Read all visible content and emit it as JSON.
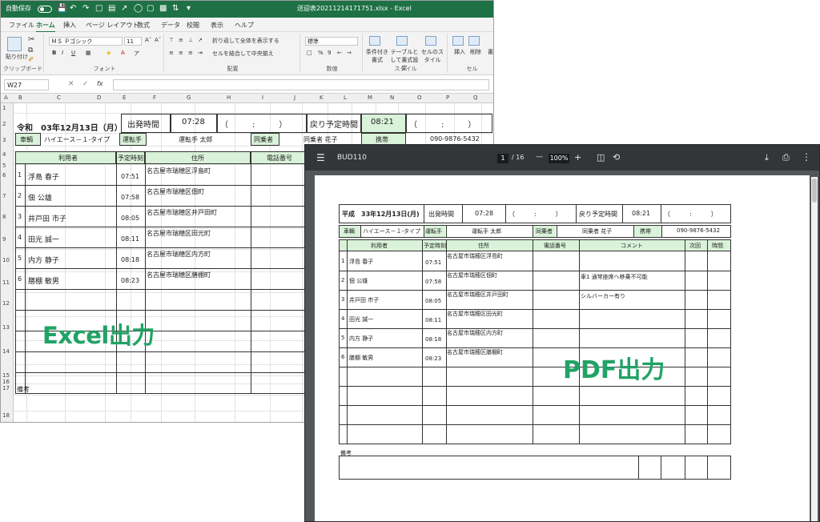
{
  "excel": {
    "autosave_label": "自動保存",
    "toggle_state": "オフ",
    "file_title": "送迎表20211214171751.xlsx - Excel",
    "menu_tabs": [
      "ファイル",
      "ホーム",
      "挿入",
      "ページ レイアウト",
      "数式",
      "データ",
      "校閲",
      "表示",
      "ヘルプ"
    ],
    "ribbon": {
      "paste": "貼り付け",
      "clipboard": "クリップボード",
      "font_name": "ＭＳ Ｐゴシック",
      "font_size": "11",
      "font": "フォント",
      "wrap": "折り返して全体を表示する",
      "merge": "セルを結合して中央揃え",
      "alignment": "配置",
      "number_format": "標準",
      "number": "数値",
      "conditional": "条件付き書式",
      "table_format": "テーブルとして書式設定",
      "cell_style": "セルのスタイル",
      "style": "スタイル",
      "insert": "挿入",
      "delete": "削除",
      "format": "書",
      "cells": "セル"
    },
    "name_box": "W27",
    "fx": "fx",
    "columns": [
      "A",
      "B",
      "C",
      "D",
      "E",
      "F",
      "G",
      "H",
      "I",
      "J",
      "K",
      "L",
      "M",
      "N",
      "O",
      "P",
      "Q"
    ],
    "rows": [
      "1",
      "2",
      "3",
      "4",
      "5",
      "6",
      "7",
      "8",
      "9",
      "10",
      "11",
      "12",
      "13",
      "14",
      "15",
      "16",
      "17",
      "18"
    ],
    "sheet": {
      "date": "令和　03年12月13日（月）",
      "departure_label": "出発時間",
      "departure_time": "07:28",
      "paren_blank": "（　　　:　　　）",
      "return_label": "戻り予定時間",
      "return_time": "08:21",
      "vehicle_label": "車輌",
      "vehicle": "ハイエース－１-タイプ",
      "driver_label": "運転手",
      "driver": "運転手 太郎",
      "companion_label": "同乗者",
      "companion": "同乗者 花子",
      "mobile_label": "携帯",
      "mobile": "090-9876-5432",
      "headers": [
        "利用者",
        "予定時刻",
        "住所",
        "電話番号"
      ],
      "remarks_label": "備考",
      "passengers": [
        {
          "no": "1",
          "name": "浮島 春子",
          "time": "07:51",
          "address": "名古屋市瑞穂区浮島町"
        },
        {
          "no": "2",
          "name": "佃 公雄",
          "time": "07:58",
          "address": "名古屋市瑞穂区佃町"
        },
        {
          "no": "3",
          "name": "井戸田 市子",
          "time": "08:05",
          "address": "名古屋市瑞穂区井戸田町"
        },
        {
          "no": "4",
          "name": "田光 誠一",
          "time": "08:11",
          "address": "名古屋市瑞穂区田光町"
        },
        {
          "no": "5",
          "name": "内方 静子",
          "time": "08:18",
          "address": "名古屋市瑞穂区内方町"
        },
        {
          "no": "6",
          "name": "膳棚 敏男",
          "time": "08:23",
          "address": "名古屋市瑞穂区膳棚町"
        }
      ]
    },
    "overlay_label": "Excel出力"
  },
  "pdf": {
    "doc_title": "BUD110",
    "page_current": "1",
    "page_total": "/ 16",
    "zoom_minus": "—",
    "zoom_value": "100%",
    "zoom_plus": "+",
    "sheet": {
      "date": "平成　33年12月13日(月)",
      "departure_label": "出発時間",
      "departure_time": "07:28",
      "paren_blank": "（　　　:　　　）",
      "return_label": "戻り予定時間",
      "return_time": "08:21",
      "vehicle_label": "車輌",
      "vehicle": "ハイエース－１-タイプ",
      "driver_label": "運転手",
      "driver": "運転手 太郎",
      "companion_label": "同乗者",
      "companion": "同乗者 花子",
      "mobile_label": "携帯",
      "mobile": "090-9876-5432",
      "headers": [
        "利用者",
        "予定時刻",
        "住所",
        "電話番号",
        "コメント",
        "次回",
        "時間"
      ],
      "remarks_label": "備考",
      "passengers": [
        {
          "no": "1",
          "name": "浮島 春子",
          "time": "07:51",
          "address": "名古屋市瑞穂区浮島町",
          "comment": ""
        },
        {
          "no": "2",
          "name": "佃 公雄",
          "time": "07:58",
          "address": "名古屋市瑞穂区佃町",
          "comment": "車1 通常座席へ移乗不可能"
        },
        {
          "no": "3",
          "name": "井戸田 市子",
          "time": "08:05",
          "address": "名古屋市瑞穂区井戸田町",
          "comment": "シルバーカー有り"
        },
        {
          "no": "4",
          "name": "田光 誠一",
          "time": "08:11",
          "address": "名古屋市瑞穂区田光町",
          "comment": ""
        },
        {
          "no": "5",
          "name": "内方 静子",
          "time": "08:18",
          "address": "名古屋市瑞穂区内方町",
          "comment": ""
        },
        {
          "no": "6",
          "name": "膳棚 敏男",
          "time": "08:23",
          "address": "名古屋市瑞穂区膳棚町",
          "comment": ""
        }
      ]
    },
    "overlay_label": "PDF出力"
  },
  "colors": {
    "excel_green": "#1e7145",
    "overlay_green": "#21a366",
    "header_green": "#d9f2d9",
    "pdf_toolbar": "#323639"
  }
}
